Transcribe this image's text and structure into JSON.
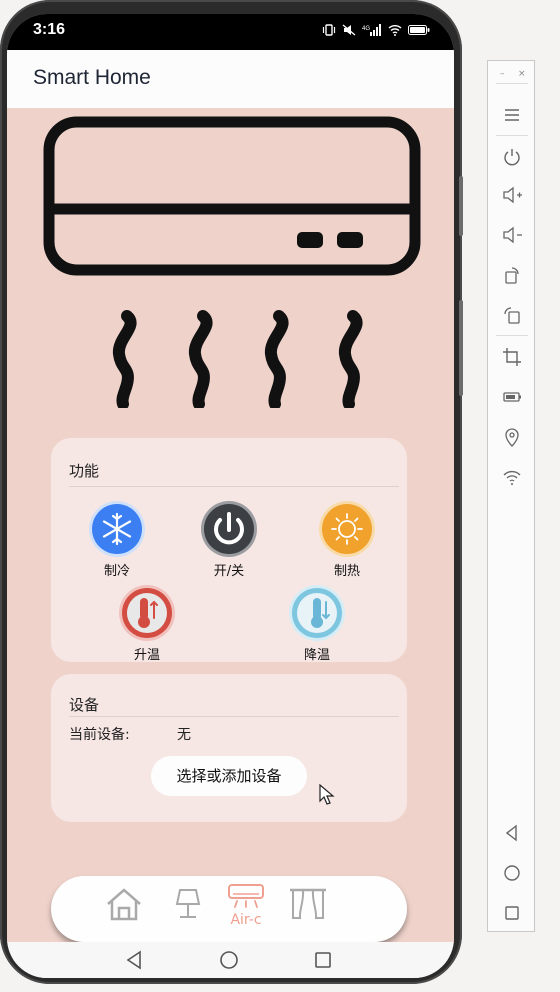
{
  "status_bar": {
    "time": "3:16",
    "icons": [
      "vibrate-icon",
      "mute-icon",
      "signal-icon",
      "wifi-icon",
      "battery-icon"
    ]
  },
  "app": {
    "title": "Smart Home"
  },
  "function_card": {
    "title": "功能",
    "buttons": [
      {
        "label": "制冷",
        "icon": "snowflake-icon",
        "color": "#3b7ff2"
      },
      {
        "label": "开/关",
        "icon": "power-icon",
        "color": "#3c3f44"
      },
      {
        "label": "制热",
        "icon": "sun-icon",
        "color": "#f0a22c"
      },
      {
        "label": "升温",
        "icon": "thermometer-up-icon",
        "color": "#d44d43"
      },
      {
        "label": "降温",
        "icon": "thermometer-down-icon",
        "color": "#7ec6e0"
      }
    ]
  },
  "device_card": {
    "title": "设备",
    "current_label": "当前设备:",
    "current_value": "无",
    "select_button": "选择或添加设备"
  },
  "tabbar": {
    "tabs": [
      {
        "icon": "home-icon",
        "label": ""
      },
      {
        "icon": "lamp-icon",
        "label": ""
      },
      {
        "icon": "air-conditioner-icon",
        "label": "Air-c",
        "active": true
      },
      {
        "icon": "curtain-icon",
        "label": ""
      }
    ],
    "active_color": "#f0a090"
  },
  "colors": {
    "background": "#efd3cb",
    "card": "#f6e7e5",
    "appbar": "#fdfcfc"
  }
}
